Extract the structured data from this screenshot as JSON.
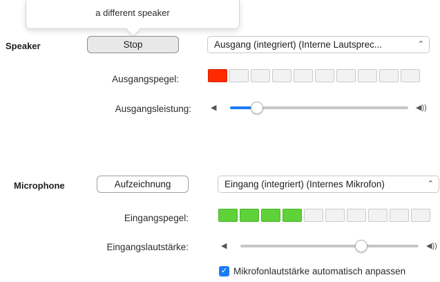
{
  "tooltip": {
    "text": "a different speaker"
  },
  "speaker": {
    "section_label": "Speaker",
    "test_button": "Stop",
    "device_select": "Ausgang (integriert) (Interne Lautsprec...",
    "output_level_label": "Ausgangspegel:",
    "output_level_segments": [
      1,
      0,
      0,
      0,
      0,
      0,
      0,
      0,
      0,
      0
    ],
    "output_volume_label": "Ausgangsleistung:",
    "output_volume_fraction": 0.15
  },
  "microphone": {
    "section_label": "Microphone",
    "test_button": "Aufzeichnung",
    "device_select": "Eingang (integriert) (Internes Mikrofon)",
    "input_level_label": "Eingangspegel:",
    "input_level_segments": [
      1,
      1,
      1,
      1,
      0,
      0,
      0,
      0,
      0,
      0
    ],
    "input_volume_label": "Eingangslautstärke:",
    "input_volume_fraction": 0.68,
    "auto_adjust_checked": true,
    "auto_adjust_label": "Mikrofonlautstärke automatisch anpassen"
  },
  "icons": {
    "volume_low": "speaker-low-icon",
    "volume_high": "speaker-high-icon",
    "select_chevron": "up-down-chevron-icon"
  },
  "colors": {
    "output_level_active": "#ff2a00",
    "input_level_active": "#5fd23a",
    "slider_accent": "#1a7cf5"
  }
}
